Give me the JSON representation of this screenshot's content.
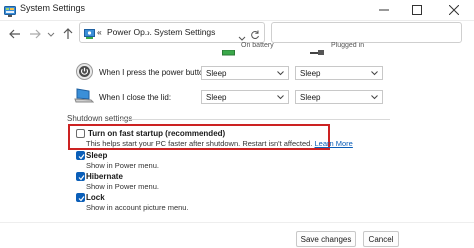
{
  "window": {
    "title": "System Settings",
    "app_icon": "control-panel-icon"
  },
  "address_bar": {
    "breadcrumb": [
      "«",
      "Power Op...",
      "System Settings"
    ],
    "icon": "power-options-icon"
  },
  "search": {
    "placeholder": ""
  },
  "columns": {
    "battery": "On battery",
    "plugged": "Plugged in"
  },
  "power_rows": [
    {
      "label": "When I press the power button:",
      "icon": "power-button-icon",
      "battery": "Sleep",
      "plugged": "Sleep"
    },
    {
      "label": "When I close the lid:",
      "icon": "laptop-lid-icon",
      "battery": "Sleep",
      "plugged": "Sleep"
    }
  ],
  "shutdown": {
    "title": "Shutdown settings",
    "options": [
      {
        "title": "Turn on fast startup (recommended)",
        "desc": "This helps start your PC faster after shutdown. Restart isn't affected.",
        "link": "Learn More",
        "checked": false
      },
      {
        "title": "Sleep",
        "desc": "Show in Power menu.",
        "checked": true
      },
      {
        "title": "Hibernate",
        "desc": "Show in Power menu.",
        "checked": true
      },
      {
        "title": "Lock",
        "desc": "Show in account picture menu.",
        "checked": true
      }
    ]
  },
  "buttons": {
    "save": "Save changes",
    "cancel": "Cancel"
  },
  "colors": {
    "highlight": "#cc2222",
    "accent": "#0a5eb8"
  }
}
